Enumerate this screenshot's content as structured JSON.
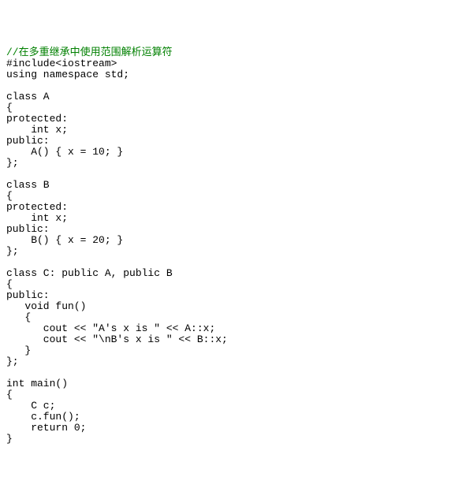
{
  "source_code": {
    "lines": [
      {
        "text": "//在多重继承中使用范围解析运算符",
        "type": "comment"
      },
      {
        "text": "#include<iostream>",
        "type": "code"
      },
      {
        "text": "using namespace std;",
        "type": "code"
      },
      {
        "text": "",
        "type": "blank"
      },
      {
        "text": "class A",
        "type": "code"
      },
      {
        "text": "{",
        "type": "code"
      },
      {
        "text": "protected:",
        "type": "code"
      },
      {
        "text": "    int x;",
        "type": "code"
      },
      {
        "text": "public:",
        "type": "code"
      },
      {
        "text": "    A() { x = 10; }",
        "type": "code"
      },
      {
        "text": "};",
        "type": "code"
      },
      {
        "text": "",
        "type": "blank"
      },
      {
        "text": "class B",
        "type": "code"
      },
      {
        "text": "{",
        "type": "code"
      },
      {
        "text": "protected:",
        "type": "code"
      },
      {
        "text": "    int x;",
        "type": "code"
      },
      {
        "text": "public:",
        "type": "code"
      },
      {
        "text": "    B() { x = 20; }",
        "type": "code"
      },
      {
        "text": "};",
        "type": "code"
      },
      {
        "text": "",
        "type": "blank"
      },
      {
        "text": "class C: public A, public B",
        "type": "code"
      },
      {
        "text": "{",
        "type": "code"
      },
      {
        "text": "public:",
        "type": "code"
      },
      {
        "text": "   void fun()",
        "type": "code"
      },
      {
        "text": "   {",
        "type": "code"
      },
      {
        "text": "      cout << \"A's x is \" << A::x;",
        "type": "code"
      },
      {
        "text": "      cout << \"\\nB's x is \" << B::x;",
        "type": "code"
      },
      {
        "text": "   }",
        "type": "code"
      },
      {
        "text": "};",
        "type": "code"
      },
      {
        "text": "",
        "type": "blank"
      },
      {
        "text": "int main()",
        "type": "code"
      },
      {
        "text": "{",
        "type": "code"
      },
      {
        "text": "    C c;",
        "type": "code"
      },
      {
        "text": "    c.fun();",
        "type": "code"
      },
      {
        "text": "    return 0;",
        "type": "code"
      },
      {
        "text": "}",
        "type": "code"
      }
    ]
  }
}
